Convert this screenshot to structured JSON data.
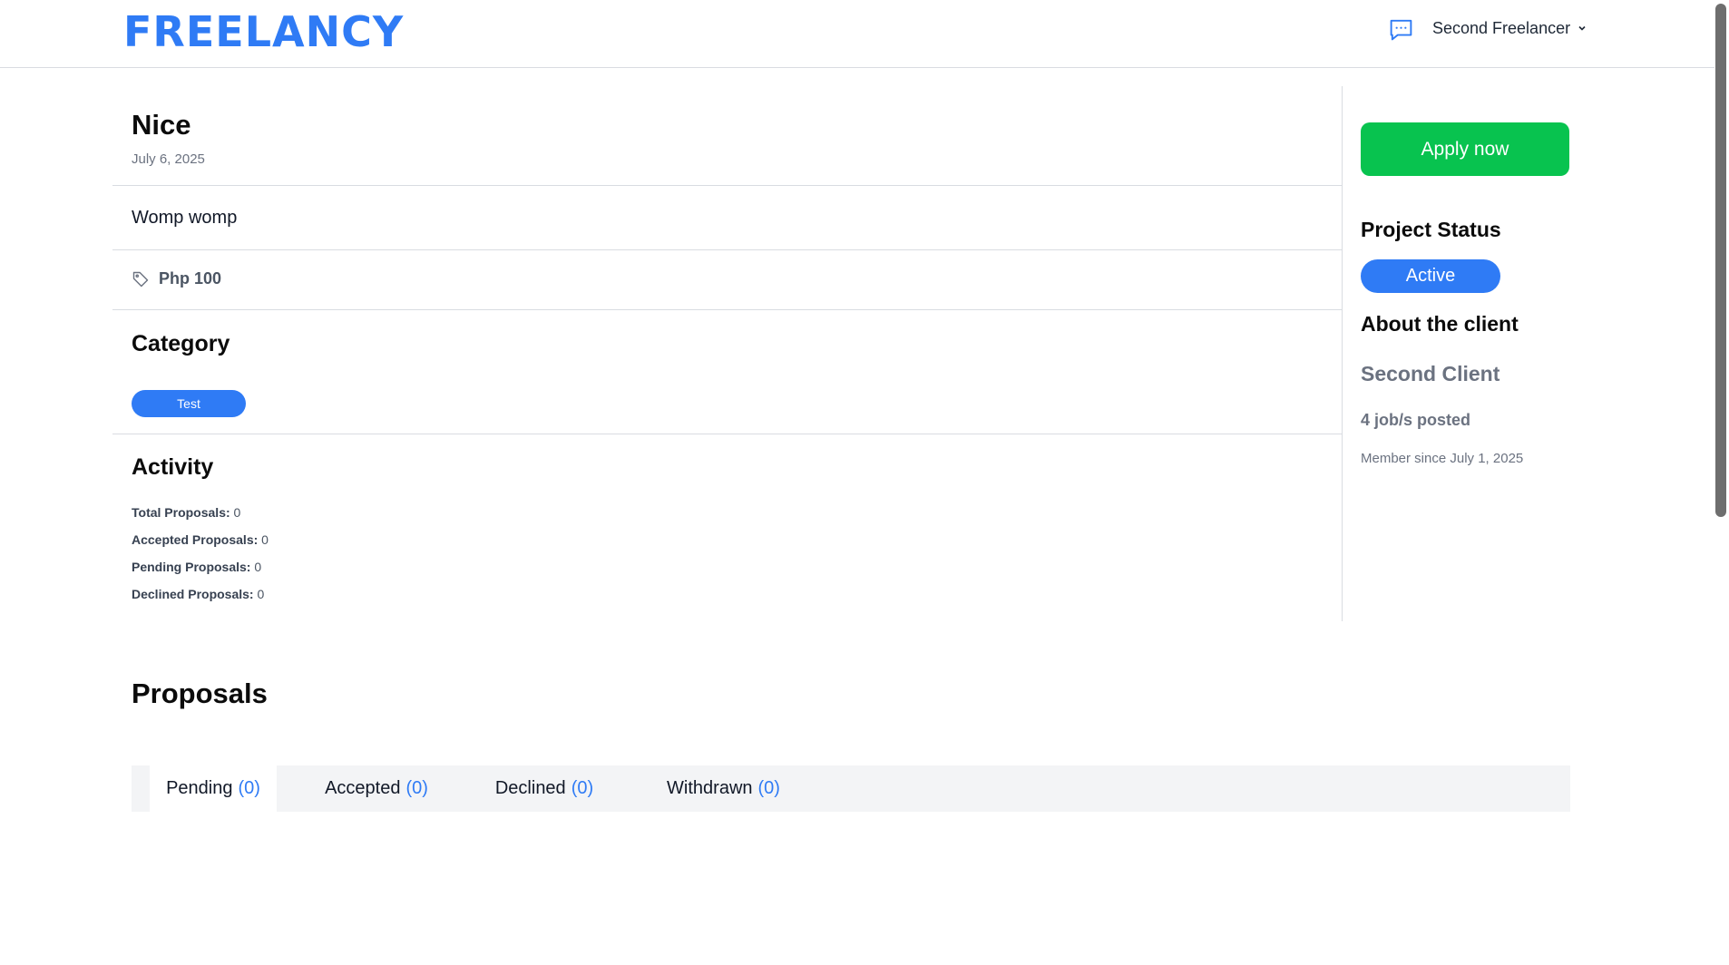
{
  "header": {
    "logo": "FREELANCY",
    "messages_icon": "chat-bubble-icon",
    "user_name": "Second Freelancer",
    "user_menu_icon": "chevron-down-icon"
  },
  "job": {
    "title": "Nice",
    "date": "July 6, 2025",
    "description": "Womp womp",
    "price_icon": "tag-icon",
    "price": "Php 100"
  },
  "category": {
    "heading": "Category",
    "tags": [
      "Test"
    ]
  },
  "activity": {
    "heading": "Activity",
    "stats": [
      {
        "label": "Total Proposals:",
        "value": "0"
      },
      {
        "label": "Accepted Proposals:",
        "value": "0"
      },
      {
        "label": "Pending Proposals:",
        "value": "0"
      },
      {
        "label": "Declined Proposals:",
        "value": "0"
      }
    ]
  },
  "sidebar": {
    "apply_label": "Apply now",
    "status_heading": "Project Status",
    "status": "Active",
    "about_heading": "About the client",
    "client_name": "Second Client",
    "jobs_posted": "4 job/s posted",
    "member_since": "Member since July 1, 2025"
  },
  "proposals": {
    "heading": "Proposals",
    "tabs": [
      {
        "label": "Pending",
        "count": "(0)"
      },
      {
        "label": "Accepted",
        "count": "(0)"
      },
      {
        "label": "Declined",
        "count": "(0)"
      },
      {
        "label": "Withdrawn",
        "count": "(0)"
      }
    ]
  },
  "colors": {
    "brand": "#2f7bf5",
    "apply": "#08c34f",
    "divider": "#d9dce1"
  }
}
